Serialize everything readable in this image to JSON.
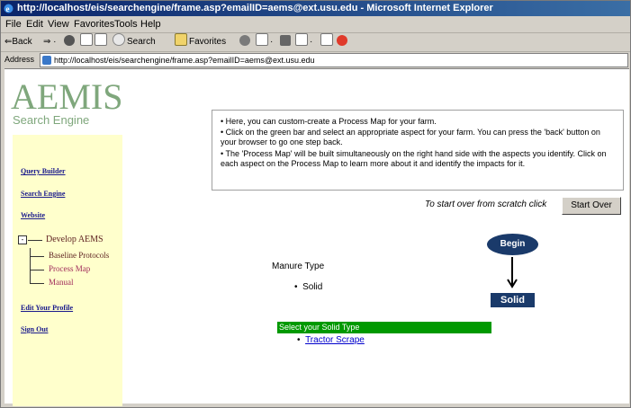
{
  "window": {
    "title": "http://localhost/eis/searchengine/frame.asp?emailID=aems@ext.usu.edu - Microsoft Internet Explorer"
  },
  "menu": [
    "File",
    "Edit",
    "View",
    "Favorites",
    "Tools",
    "Help"
  ],
  "toolbar": {
    "back": "Back",
    "search": "Search",
    "favorites": "Favorites"
  },
  "address": {
    "label": "Address",
    "url": "http://localhost/eis/searchengine/frame.asp?emailID=aems@ext.usu.edu"
  },
  "logo": {
    "title": "AEMIS",
    "subtitle": "Search Engine",
    "color": "#7fa77c"
  },
  "sidebar": {
    "links": [
      "Query Builder",
      "Search Engine",
      "Website"
    ],
    "tree": {
      "toggle": "-",
      "root": "Develop AEMS",
      "children": [
        "Baseline Protocols",
        "Process Map",
        "Manual"
      ]
    },
    "bottom_links": [
      "Edit Your Profile",
      "Sign Out"
    ]
  },
  "info": {
    "bullets": [
      "• Here, you can custom-create a Process Map for your farm.",
      "• Click on the green bar and select an appropriate aspect for your farm. You can press the 'back' button on your browser to go one step back.",
      "• The 'Process Map' will be built simultaneously on the right hand side with the aspects you identify. Click on each aspect on the Process Map to learn more about it and identify the impacts for it."
    ]
  },
  "start_over": {
    "text": "To start over from scratch click",
    "button": "Start Over"
  },
  "manure": {
    "label": "Manure Type",
    "value": "Solid"
  },
  "select": {
    "bar_label": "Select your Solid Type",
    "option": "Tractor Scrape",
    "bar_color": "#009900"
  },
  "process_map": {
    "begin": "Begin",
    "node": "Solid",
    "node_color": "#1a3a6a"
  }
}
